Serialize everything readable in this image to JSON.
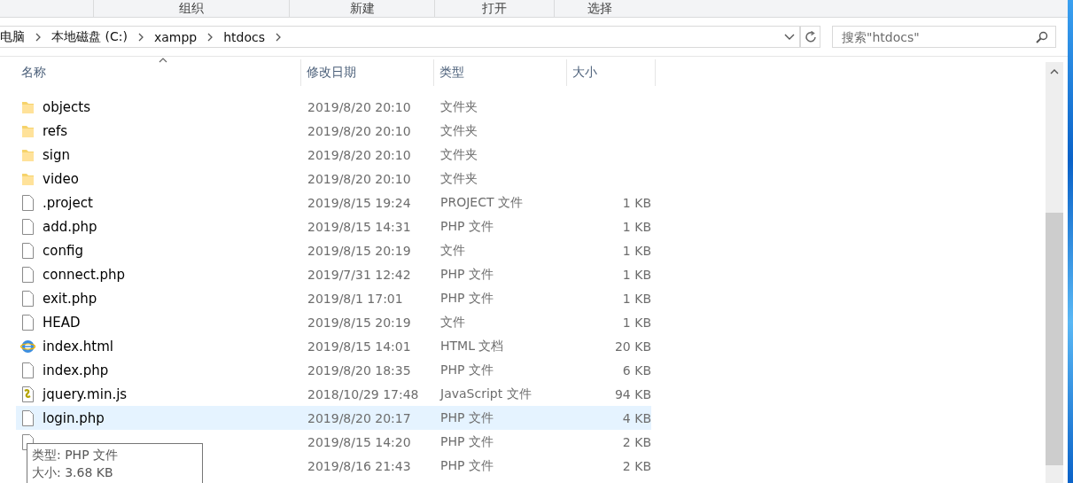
{
  "ribbon_groups": [
    "组织",
    "新建",
    "打开",
    "选择"
  ],
  "breadcrumb": [
    "电脑",
    "本地磁盘 (C:)",
    "xampp",
    "htdocs"
  ],
  "search": {
    "placeholder": "搜索\"htdocs\""
  },
  "columns": [
    {
      "label": "名称",
      "sorted": true
    },
    {
      "label": "修改日期",
      "sorted": false
    },
    {
      "label": "类型",
      "sorted": false
    },
    {
      "label": "大小",
      "sorted": false
    }
  ],
  "rows": [
    {
      "kind": "folder",
      "name": "objects",
      "date": "2019/8/20 20:10",
      "type": "文件夹",
      "selected": false
    },
    {
      "kind": "folder",
      "name": "refs",
      "date": "2019/8/20 20:10",
      "type": "文件夹",
      "selected": false
    },
    {
      "kind": "folder",
      "name": "sign",
      "date": "2019/8/20 20:10",
      "type": "文件夹",
      "selected": false
    },
    {
      "kind": "folder",
      "name": "video",
      "date": "2019/8/20 20:10",
      "type": "文件夹",
      "selected": false
    },
    {
      "kind": "file",
      "name": ".project",
      "date": "2019/8/15 19:24",
      "type": "PROJECT 文件",
      "size": "1 KB",
      "selected": false
    },
    {
      "kind": "file",
      "name": "add.php",
      "date": "2019/8/15 14:31",
      "type": "PHP 文件",
      "size": "1 KB",
      "selected": false
    },
    {
      "kind": "file",
      "name": "config",
      "date": "2019/8/15 20:19",
      "type": "文件",
      "size": "1 KB",
      "selected": false
    },
    {
      "kind": "file",
      "name": "connect.php",
      "date": "2019/7/31 12:42",
      "type": "PHP 文件",
      "size": "1 KB",
      "selected": false
    },
    {
      "kind": "file",
      "name": "exit.php",
      "date": "2019/8/1 17:01",
      "type": "PHP 文件",
      "size": "1 KB",
      "selected": false
    },
    {
      "kind": "file",
      "name": "HEAD",
      "date": "2019/8/15 20:19",
      "type": "文件",
      "size": "1 KB",
      "selected": false
    },
    {
      "kind": "html",
      "name": "index.html",
      "date": "2019/8/15 14:01",
      "type": "HTML 文档",
      "size": "20 KB",
      "selected": false
    },
    {
      "kind": "file",
      "name": "index.php",
      "date": "2019/8/20 18:35",
      "type": "PHP 文件",
      "size": "6 KB",
      "selected": false
    },
    {
      "kind": "script",
      "name": "jquery.min.js",
      "date": "2018/10/29 17:48",
      "type": "JavaScript 文件",
      "size": "94 KB",
      "selected": false
    },
    {
      "kind": "file",
      "name": "login.php",
      "date": "2019/8/20 20:17",
      "type": "PHP 文件",
      "size": "4 KB",
      "selected": true
    },
    {
      "kind": "file",
      "date": "2019/8/15 14:20",
      "type": "PHP 文件",
      "size": "2 KB",
      "selected": false
    },
    {
      "date": "2019/8/16 21:43",
      "type": "PHP 文件",
      "size": "2 KB",
      "selected": false
    }
  ],
  "tooltip": [
    "类型: PHP 文件",
    "大小: 3.68 KB"
  ]
}
